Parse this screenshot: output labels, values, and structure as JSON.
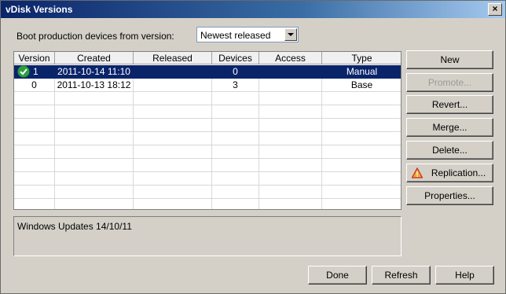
{
  "window": {
    "title": "vDisk Versions",
    "close_glyph": "×"
  },
  "boot": {
    "label": "Boot production devices from version:",
    "selected": "Newest released"
  },
  "table": {
    "columns": [
      "Version",
      "Created",
      "Released",
      "Devices",
      "Access",
      "Type"
    ],
    "rows": [
      {
        "version": "1",
        "created": "2011-10-14 11:10",
        "released": "",
        "devices": "0",
        "access": "",
        "type": "Manual",
        "selected": true,
        "icon": "check-icon"
      },
      {
        "version": "0",
        "created": "2011-10-13 18:12",
        "released": "",
        "devices": "3",
        "access": "",
        "type": "Base",
        "selected": false
      }
    ]
  },
  "side_buttons": {
    "new": "New",
    "promote": "Promote...",
    "revert": "Revert...",
    "merge": "Merge...",
    "delete": "Delete...",
    "replication": "Replication...",
    "properties": "Properties..."
  },
  "description": "Windows Updates 14/10/11",
  "bottom_buttons": {
    "done": "Done",
    "refresh": "Refresh",
    "help": "Help"
  },
  "colors": {
    "selection": "#0a246a",
    "face": "#d4d0c8",
    "warning": "#f5a623",
    "check": "#2e9e3a"
  }
}
